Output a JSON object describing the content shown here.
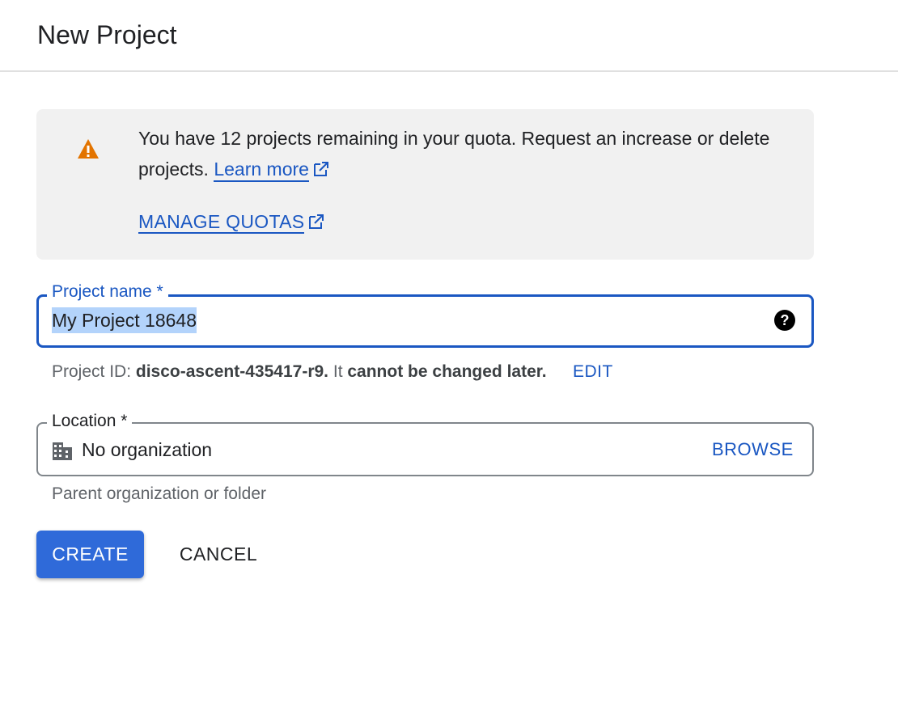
{
  "header": {
    "title": "New Project"
  },
  "quota_banner": {
    "icon": "warning-icon",
    "message": "You have 12 projects remaining in your quota. Request an increase or delete projects.",
    "learn_more": "Learn more",
    "manage_quotas": "MANAGE QUOTAS"
  },
  "project_name": {
    "label": "Project name *",
    "value": "My Project 18648",
    "help_icon": "help-icon"
  },
  "project_id": {
    "prefix": "Project ID:",
    "id": "disco-ascent-435417-r9.",
    "mid": "It",
    "note": "cannot be changed later.",
    "edit": "EDIT"
  },
  "location": {
    "label": "Location *",
    "value": "No organization",
    "browse": "BROWSE",
    "helper": "Parent organization or folder",
    "icon": "building-icon"
  },
  "actions": {
    "create": "CREATE",
    "cancel": "CANCEL"
  },
  "colors": {
    "accent": "#1a57c2",
    "primary_button": "#2f6ad9",
    "warning": "#e37400",
    "banner_bg": "#f1f1f1",
    "selection": "#b3d3fb"
  }
}
